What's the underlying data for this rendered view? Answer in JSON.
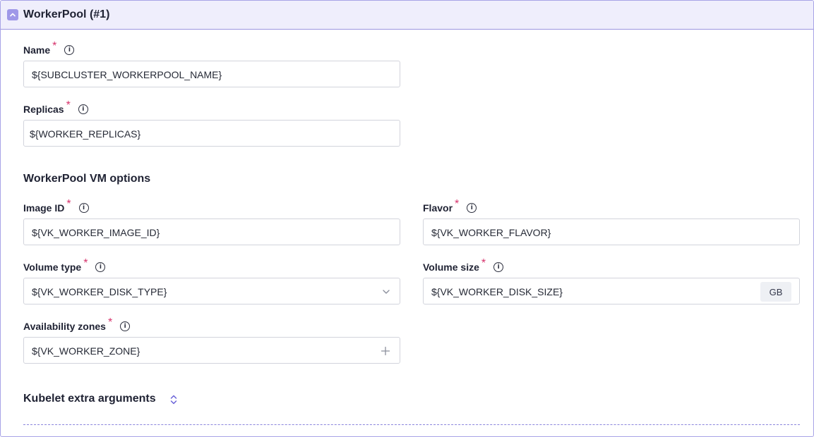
{
  "panel": {
    "title": "WorkerPool (#1)"
  },
  "fields": {
    "name": {
      "label": "Name",
      "value": "${SUBCLUSTER_WORKERPOOL_NAME}"
    },
    "replicas": {
      "label": "Replicas",
      "value": "${WORKER_REPLICAS}"
    },
    "image_id": {
      "label": "Image ID",
      "value": "${VK_WORKER_IMAGE_ID}"
    },
    "flavor": {
      "label": "Flavor",
      "value": "${VK_WORKER_FLAVOR}"
    },
    "volume_type": {
      "label": "Volume type",
      "value": "${VK_WORKER_DISK_TYPE}"
    },
    "volume_size": {
      "label": "Volume size",
      "value": "${VK_WORKER_DISK_SIZE}",
      "unit": "GB"
    },
    "availability_zones": {
      "label": "Availability zones",
      "value": "${VK_WORKER_ZONE}"
    }
  },
  "sections": {
    "vm_options": "WorkerPool VM options",
    "kubelet": "Kubelet extra arguments"
  },
  "symbols": {
    "required": "*",
    "info": "i"
  },
  "icons": {
    "toggle": "chevron-up-icon",
    "info": "info-circle-icon",
    "select": "chevron-down-icon",
    "add": "plus-icon",
    "expand": "chevron-up-down-icon"
  },
  "colors": {
    "accent": "#9f98e8",
    "header_bg": "#efeefc",
    "required": "#d6336c",
    "border": "#d2d4dc"
  }
}
